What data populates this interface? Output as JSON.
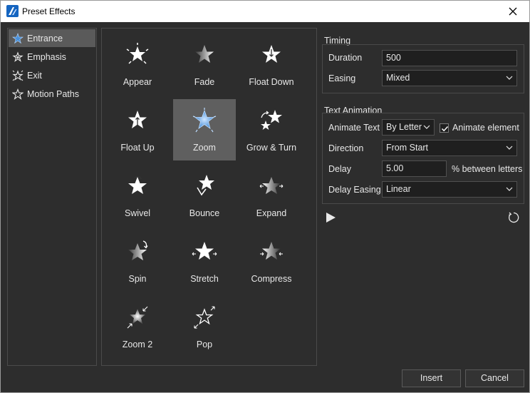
{
  "window": {
    "title": "Preset Effects"
  },
  "categories": [
    {
      "label": "Entrance",
      "icon": "entrance-star-icon"
    },
    {
      "label": "Emphasis",
      "icon": "emphasis-star-icon"
    },
    {
      "label": "Exit",
      "icon": "exit-star-icon"
    },
    {
      "label": "Motion Paths",
      "icon": "motion-path-star-icon"
    }
  ],
  "selected_category": "Entrance",
  "effects": [
    {
      "label": "Appear"
    },
    {
      "label": "Fade"
    },
    {
      "label": "Float Down"
    },
    {
      "label": "Float Up"
    },
    {
      "label": "Zoom"
    },
    {
      "label": "Grow & Turn"
    },
    {
      "label": "Swivel"
    },
    {
      "label": "Bounce"
    },
    {
      "label": "Expand"
    },
    {
      "label": "Spin"
    },
    {
      "label": "Stretch"
    },
    {
      "label": "Compress"
    },
    {
      "label": "Zoom 2"
    },
    {
      "label": "Pop"
    }
  ],
  "selected_effect": "Zoom",
  "timing": {
    "title": "Timing",
    "duration_label": "Duration",
    "duration_value": "500",
    "easing_label": "Easing",
    "easing_value": "Mixed"
  },
  "text_animation": {
    "title": "Text Animation",
    "animate_text_label": "Animate Text",
    "animate_text_value": "By Letter",
    "animate_element_label": "Animate element",
    "animate_element_checked": true,
    "direction_label": "Direction",
    "direction_value": "From Start",
    "delay_label": "Delay",
    "delay_value": "5.00",
    "delay_unit": "% between letters",
    "delay_easing_label": "Delay Easing",
    "delay_easing_value": "Linear"
  },
  "buttons": {
    "insert": "Insert",
    "cancel": "Cancel"
  },
  "colors": {
    "accent_blue": "#1565c0",
    "selected_bg": "#5f5f5f",
    "star_light": "#ffffff",
    "star_dark": "#7a7a7a"
  }
}
